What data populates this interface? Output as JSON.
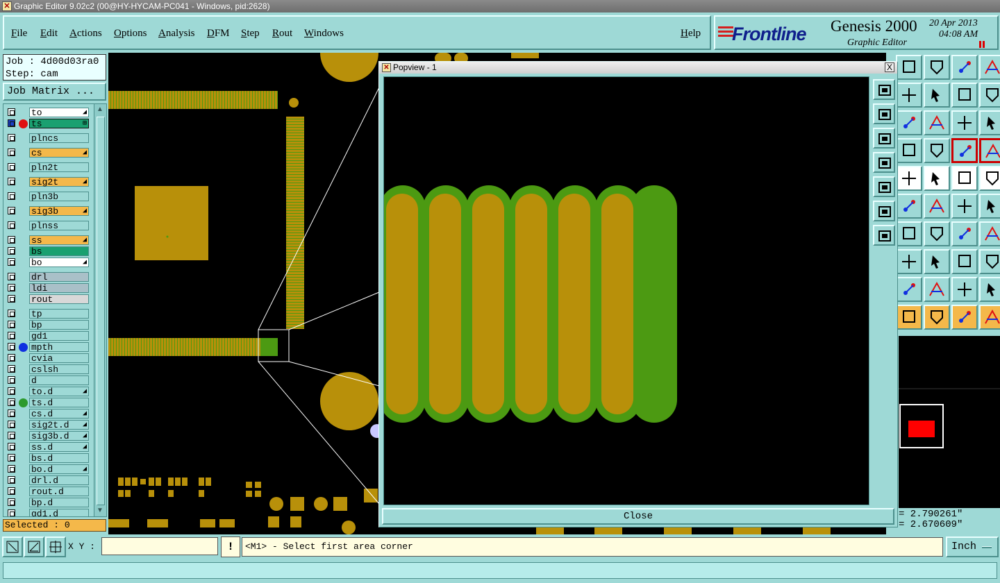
{
  "window": {
    "title": "Graphic Editor 9.02c2 (00@HY-HYCAM-PC041 - Windows, pid:2628)",
    "icon": "x-app-icon"
  },
  "menu": {
    "items": [
      "File",
      "Edit",
      "Actions",
      "Options",
      "Analysis",
      "DFM",
      "Step",
      "Rout",
      "Windows"
    ],
    "help": "Help"
  },
  "brand": {
    "logo": "Frontline",
    "product": "Genesis 2000",
    "subtitle": "Graphic Editor",
    "date": "20 Apr 2013",
    "time": "04:08 AM"
  },
  "job": {
    "job_label": "Job : 4d00d03ra0",
    "step_label": "Step: cam",
    "matrix_button": "Job Matrix ..."
  },
  "layers": [
    {
      "name": "to",
      "color": "#ffffff",
      "dot": "",
      "aff": "◢"
    },
    {
      "name": "ts",
      "color": "#1aa070",
      "dot": "#e01010",
      "aff": "⊞",
      "selected": true,
      "sep_after": true
    },
    {
      "name": "plncs",
      "color": "#9ed9d6",
      "dot": "",
      "aff": "",
      "sep_after": true
    },
    {
      "name": "cs",
      "color": "#f4b84a",
      "dot": "",
      "aff": "◢",
      "sep_after": true
    },
    {
      "name": "pln2t",
      "color": "#9ed9d6",
      "dot": "",
      "aff": "",
      "sep_after": true
    },
    {
      "name": "sig2t",
      "color": "#f4b84a",
      "dot": "",
      "aff": "◢",
      "sep_after": true
    },
    {
      "name": "pln3b",
      "color": "#9ed9d6",
      "dot": "",
      "aff": "",
      "sep_after": true
    },
    {
      "name": "sig3b",
      "color": "#f4b84a",
      "dot": "",
      "aff": "◢",
      "sep_after": true
    },
    {
      "name": "plnss",
      "color": "#9ed9d6",
      "dot": "",
      "aff": "",
      "sep_after": true
    },
    {
      "name": "ss",
      "color": "#f4b84a",
      "dot": "",
      "aff": "◢"
    },
    {
      "name": "bs",
      "color": "#1aa070",
      "dot": "",
      "aff": ""
    },
    {
      "name": "bo",
      "color": "#ffffff",
      "dot": "",
      "aff": "◢",
      "sep_after": true
    },
    {
      "name": "drl",
      "color": "#a9c0c8",
      "dot": "",
      "aff": ""
    },
    {
      "name": "ldi",
      "color": "#a9c0c8",
      "dot": "",
      "aff": ""
    },
    {
      "name": "rout",
      "color": "#d8d8d8",
      "dot": "",
      "aff": "",
      "sep_after": true
    },
    {
      "name": "tp",
      "color": "#9ed9d6",
      "dot": "",
      "aff": ""
    },
    {
      "name": "bp",
      "color": "#9ed9d6",
      "dot": "",
      "aff": ""
    },
    {
      "name": "gd1",
      "color": "#9ed9d6",
      "dot": "",
      "aff": ""
    },
    {
      "name": "mpth",
      "color": "#9ed9d6",
      "dot": "#1030e0",
      "aff": ""
    },
    {
      "name": "cvia",
      "color": "#9ed9d6",
      "dot": "",
      "aff": ""
    },
    {
      "name": "cslsh",
      "color": "#9ed9d6",
      "dot": "",
      "aff": ""
    },
    {
      "name": "d",
      "color": "#9ed9d6",
      "dot": "",
      "aff": ""
    },
    {
      "name": "to.d",
      "color": "#9ed9d6",
      "dot": "",
      "aff": "◢"
    },
    {
      "name": "ts.d",
      "color": "#9ed9d6",
      "dot": "#2c9a2c",
      "aff": ""
    },
    {
      "name": "cs.d",
      "color": "#9ed9d6",
      "dot": "",
      "aff": "◢"
    },
    {
      "name": "sig2t.d",
      "color": "#9ed9d6",
      "dot": "",
      "aff": "◢"
    },
    {
      "name": "sig3b.d",
      "color": "#9ed9d6",
      "dot": "",
      "aff": "◢"
    },
    {
      "name": "ss.d",
      "color": "#9ed9d6",
      "dot": "",
      "aff": "◢"
    },
    {
      "name": "bs.d",
      "color": "#9ed9d6",
      "dot": "",
      "aff": ""
    },
    {
      "name": "bo.d",
      "color": "#9ed9d6",
      "dot": "",
      "aff": "◢"
    },
    {
      "name": "drl.d",
      "color": "#9ed9d6",
      "dot": "",
      "aff": ""
    },
    {
      "name": "rout.d",
      "color": "#9ed9d6",
      "dot": "",
      "aff": ""
    },
    {
      "name": "bp.d",
      "color": "#9ed9d6",
      "dot": "",
      "aff": ""
    },
    {
      "name": "gd1.d",
      "color": "#9ed9d6",
      "dot": "",
      "aff": ""
    }
  ],
  "selected": "Selected : 0",
  "popview": {
    "title": "Popview - 1",
    "close_x": "X",
    "close_button": "Close"
  },
  "coords": {
    "x": "= 2.790261\"",
    "y": "= 2.670609\""
  },
  "bottom": {
    "xy_label": "X Y :",
    "xy_value": "",
    "bang": "!",
    "prompt": "<M1> - Select first area corner",
    "unit": "Inch"
  },
  "colors": {
    "pad": "#b8900a",
    "mask": "#4c9a12",
    "bg": "#9ed9d6",
    "canvas": "#000000"
  }
}
